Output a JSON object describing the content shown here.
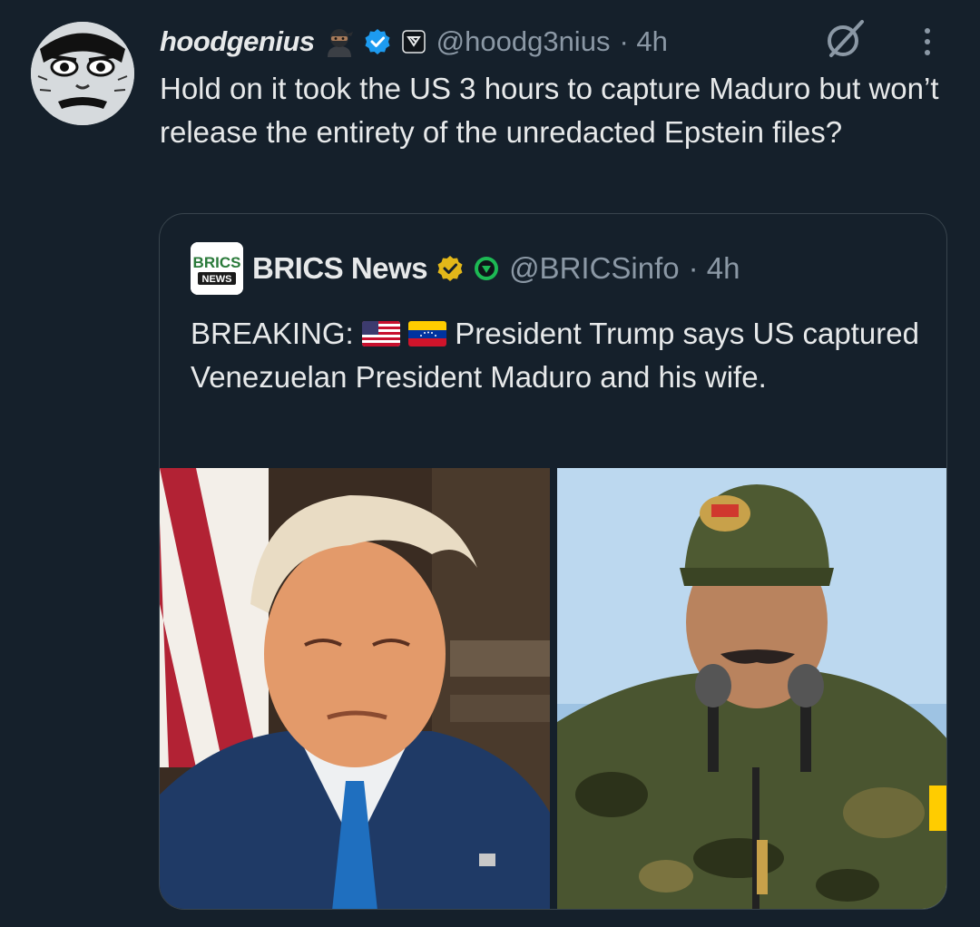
{
  "tweet": {
    "display_name": "hoodgenius",
    "handle": "@hoodg3nius",
    "time": "· 4h",
    "text": "Hold on it took the US 3 hours to capture Maduro but won’t release the entirety of the unredacted Epstein files?",
    "icons": [
      "ninja-emoji",
      "verified-badge",
      "affiliate-badge",
      "grok-icon",
      "more-icon"
    ],
    "verified_color": "#1d9bf0"
  },
  "quote": {
    "display_name": "BRICS News",
    "handle": "@BRICSinfo",
    "time": "· 4h",
    "text_prefix": "BREAKING:",
    "text_body": "President Trump says US captured Venezuelan President Maduro and his wife.",
    "avatar_text": [
      "BRICS",
      "NEWS"
    ],
    "verified_color": "#e2b719",
    "affiliate_color": "#1db954",
    "icons": [
      "us-flag-emoji",
      "venezuela-flag-emoji"
    ],
    "media": [
      "trump-photo",
      "maduro-photo"
    ]
  },
  "colors": {
    "background": "#15202b",
    "text": "#e7e9ea",
    "secondary": "#8b98a5",
    "border": "#38444d"
  }
}
